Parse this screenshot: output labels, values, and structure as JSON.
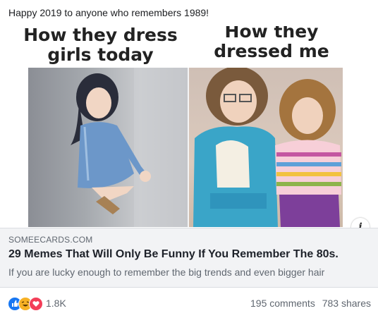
{
  "post": {
    "text": "Happy 2019 to anyone who remembers 1989!"
  },
  "media": {
    "caption_left": "How they dress girls today",
    "caption_right": "How they dressed me",
    "info_icon": "info-icon"
  },
  "link": {
    "domain": "SOMEECARDS.COM",
    "headline": "29 Memes That Will Only Be Funny If You Remember The 80s.",
    "description": "If you are lucky enough to remember the big trends and even bigger hair"
  },
  "footer": {
    "reactions": [
      "like-icon",
      "haha-icon",
      "love-icon"
    ],
    "reaction_count": "1.8K",
    "comments": "195 comments",
    "shares": "783 shares"
  },
  "colors": {
    "like": "#1877f2",
    "haha": "#f7b125",
    "love": "#f33e58",
    "link_bg": "#f2f3f5"
  }
}
